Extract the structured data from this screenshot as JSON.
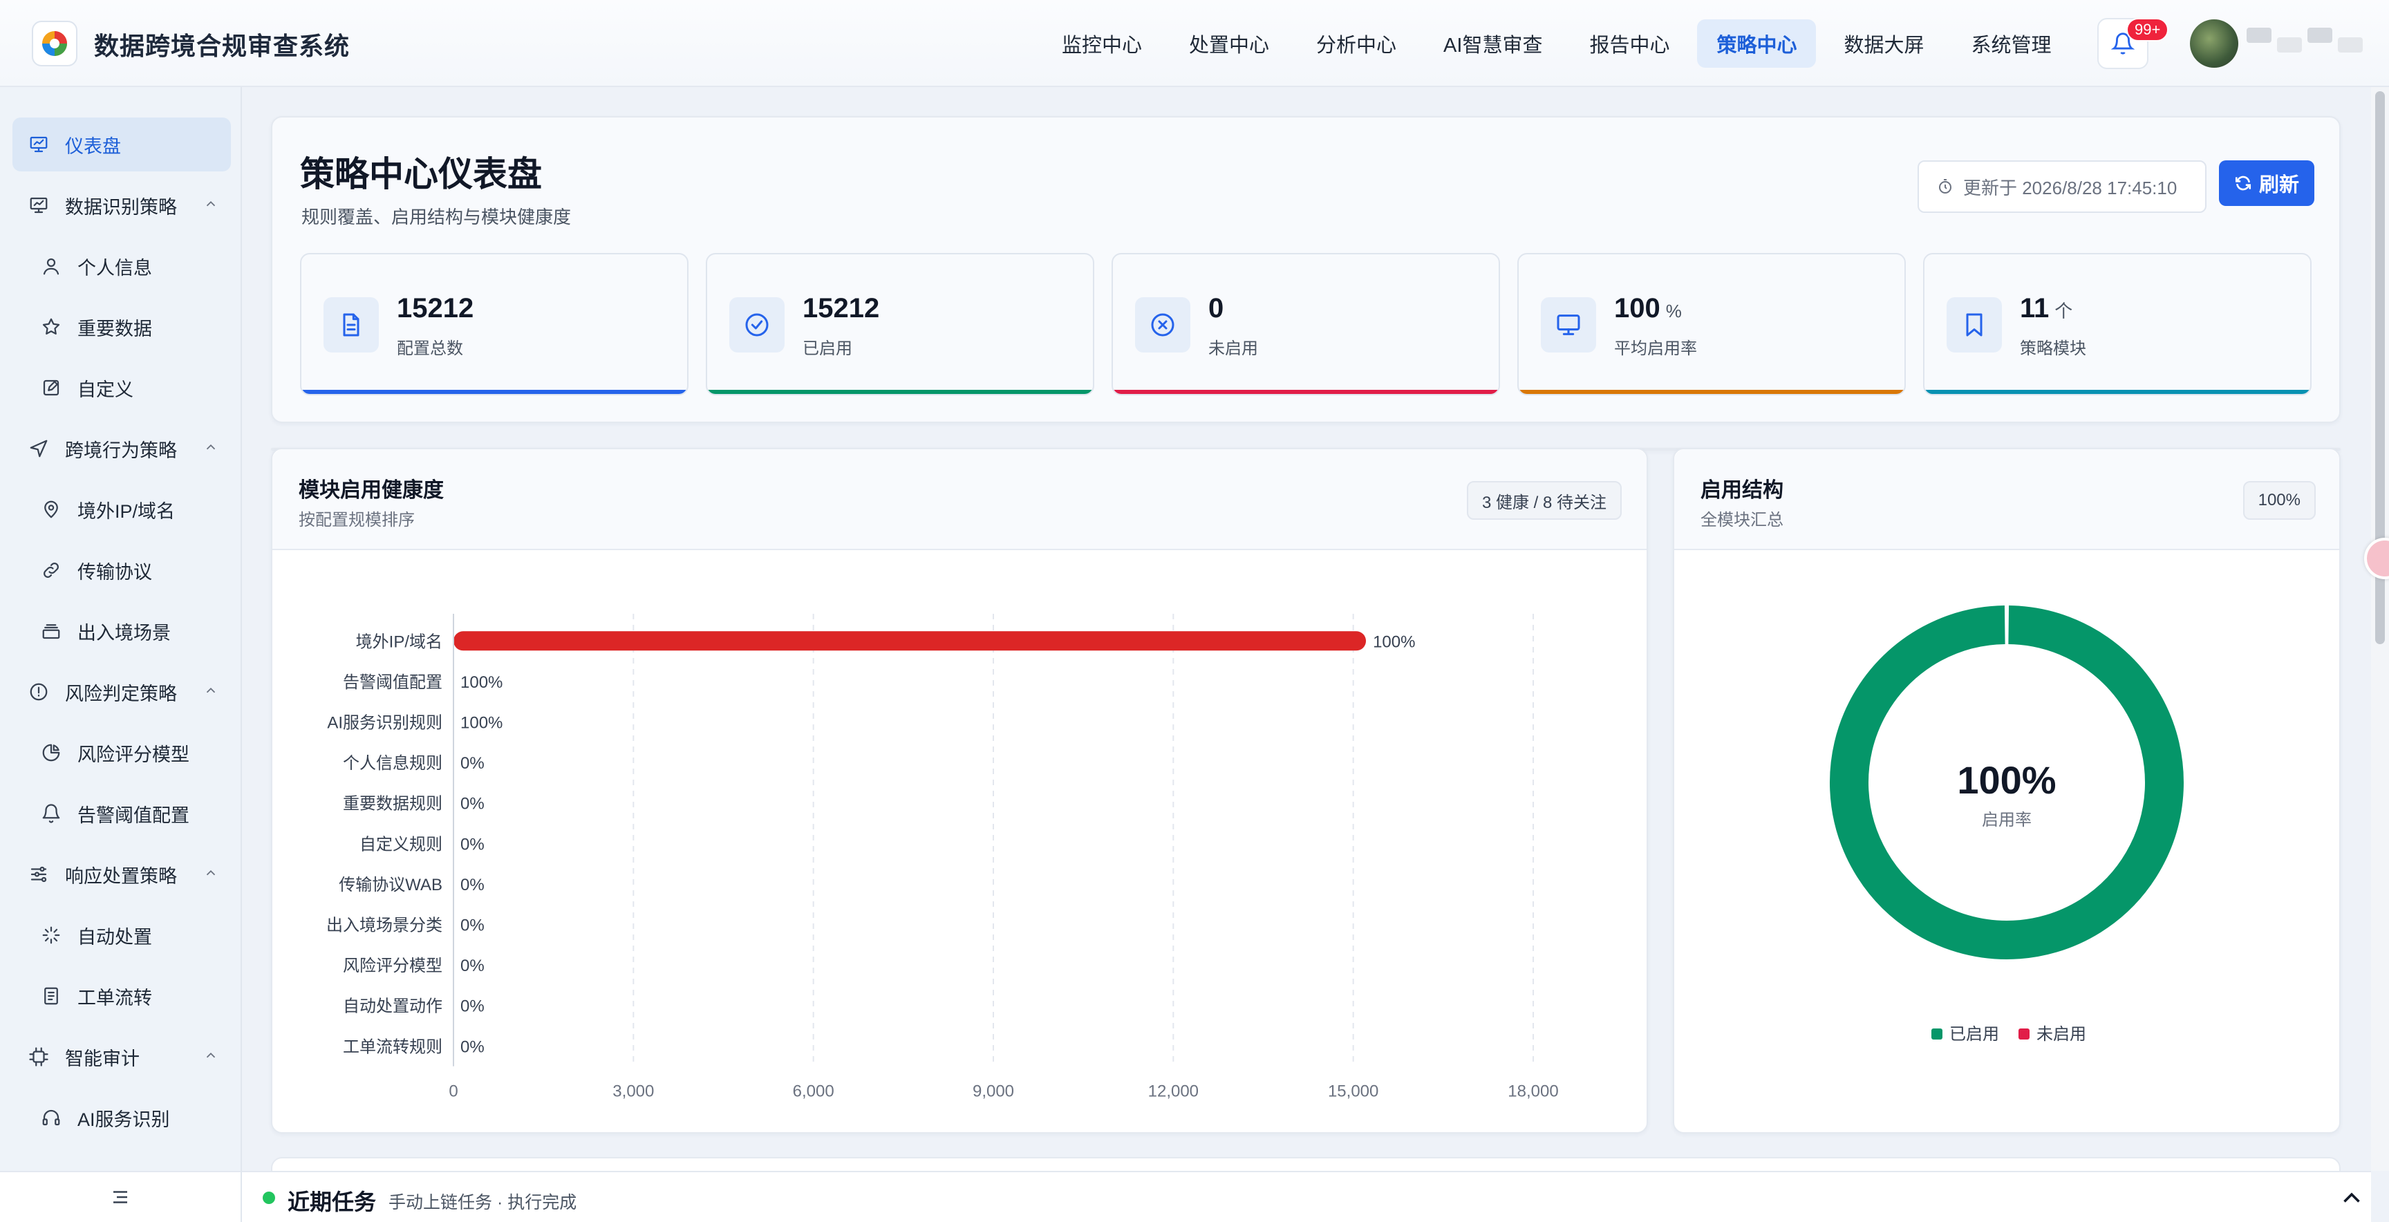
{
  "app": {
    "title": "数据跨境合规审查系统"
  },
  "topnav": [
    {
      "label": "监控中心",
      "active": false
    },
    {
      "label": "处置中心",
      "active": false
    },
    {
      "label": "分析中心",
      "active": false
    },
    {
      "label": "AI智慧审查",
      "active": false
    },
    {
      "label": "报告中心",
      "active": false
    },
    {
      "label": "策略中心",
      "active": true
    },
    {
      "label": "数据大屏",
      "active": false
    },
    {
      "label": "系统管理",
      "active": false
    }
  ],
  "notifications": {
    "badge": "99+"
  },
  "sidebar": {
    "items": [
      {
        "label": "仪表盘",
        "icon": "dashboard-icon",
        "level": 0,
        "active": true
      },
      {
        "label": "数据识别策略",
        "icon": "data-identify-icon",
        "level": 0,
        "expanded": true
      },
      {
        "label": "个人信息",
        "icon": "user-icon",
        "level": 1
      },
      {
        "label": "重要数据",
        "icon": "star-icon",
        "level": 1
      },
      {
        "label": "自定义",
        "icon": "edit-icon",
        "level": 1
      },
      {
        "label": "跨境行为策略",
        "icon": "send-icon",
        "level": 0,
        "expanded": true
      },
      {
        "label": "境外IP/域名",
        "icon": "location-icon",
        "level": 1
      },
      {
        "label": "传输协议",
        "icon": "link-icon",
        "level": 1
      },
      {
        "label": "出入境场景",
        "icon": "layers-icon",
        "level": 1
      },
      {
        "label": "风险判定策略",
        "icon": "alert-circle-icon",
        "level": 0,
        "expanded": true
      },
      {
        "label": "风险评分模型",
        "icon": "pie-icon",
        "level": 1
      },
      {
        "label": "告警阈值配置",
        "icon": "bell-icon",
        "level": 1
      },
      {
        "label": "响应处置策略",
        "icon": "sliders-icon",
        "level": 0,
        "expanded": true
      },
      {
        "label": "自动处置",
        "icon": "loader-icon",
        "level": 1
      },
      {
        "label": "工单流转",
        "icon": "doc-icon",
        "level": 1
      },
      {
        "label": "智能审计",
        "icon": "chip-icon",
        "level": 0,
        "expanded": true
      },
      {
        "label": "AI服务识别",
        "icon": "headset-icon",
        "level": 1
      }
    ]
  },
  "header": {
    "title": "策略中心仪表盘",
    "subtitle": "规则覆盖、启用结构与模块健康度",
    "updated": "更新于 2026/8/28 17:45:10",
    "refresh_label": "刷新"
  },
  "stats": [
    {
      "value": "15212",
      "unit": "",
      "label": "配置总数",
      "icon": "file-icon",
      "color": "#2563eb"
    },
    {
      "value": "15212",
      "unit": "",
      "label": "已启用",
      "icon": "check-circle-icon",
      "color": "#059669"
    },
    {
      "value": "0",
      "unit": "",
      "label": "未启用",
      "icon": "x-circle-icon",
      "color": "#e11d48"
    },
    {
      "value": "100",
      "unit": "%",
      "label": "平均启用率",
      "icon": "monitor-icon",
      "color": "#d97706"
    },
    {
      "value": "11",
      "unit": "个",
      "label": "策略模块",
      "icon": "bookmark-icon",
      "color": "#0891b2"
    }
  ],
  "health_panel": {
    "title": "模块启用健康度",
    "subtitle": "按配置规模排序",
    "pill": "3 健康 / 8 待关注"
  },
  "structure_panel": {
    "title": "启用结构",
    "subtitle": "全模块汇总",
    "pill": "100%",
    "center_value": "100%",
    "center_label": "启用率"
  },
  "chart_data": [
    {
      "type": "bar",
      "orientation": "horizontal",
      "categories": [
        "境外IP/域名",
        "告警阈值配置",
        "AI服务识别规则",
        "个人信息规则",
        "重要数据规则",
        "自定义规则",
        "传输协议WAB",
        "出入境场景分类",
        "风险评分模型",
        "自动处置动作",
        "工单流转规则"
      ],
      "values": [
        15212,
        0,
        0,
        0,
        0,
        0,
        0,
        0,
        0,
        0,
        0
      ],
      "data_labels": [
        "100%",
        "100%",
        "100%",
        "0%",
        "0%",
        "0%",
        "0%",
        "0%",
        "0%",
        "0%",
        "0%"
      ],
      "xlim": [
        0,
        18000
      ],
      "xticks": [
        "0",
        "3,000",
        "6,000",
        "9,000",
        "12,000",
        "15,000",
        "18,000"
      ],
      "bar_color": "#dc2626",
      "grid": "vertical-dashed"
    },
    {
      "type": "pie",
      "style": "donut",
      "categories": [
        "已启用",
        "未启用"
      ],
      "values": [
        15212,
        0
      ],
      "colors": [
        "#059669",
        "#e11d48"
      ],
      "legend": "bottom"
    }
  ],
  "bottom_bar": {
    "title": "近期任务",
    "subtitle": "手动上链任务 · 执行完成"
  }
}
